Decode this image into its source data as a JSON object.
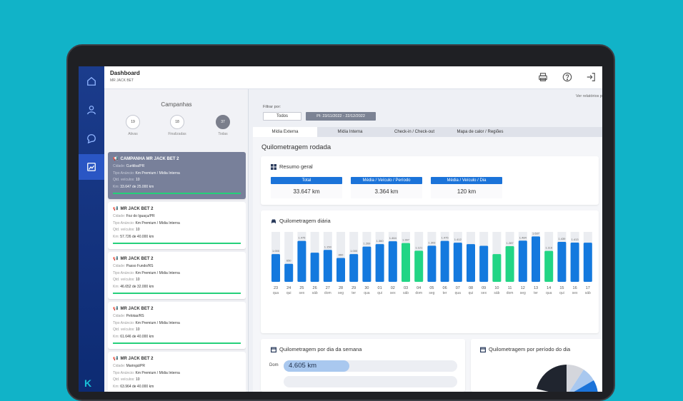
{
  "header": {
    "title": "Dashboard",
    "subtitle": "MR JACK BET"
  },
  "campaigns_panel": {
    "title": "Campanhas",
    "counters": [
      {
        "value": "19",
        "label": "Ativas"
      },
      {
        "value": "18",
        "label": "Finalizadas"
      },
      {
        "value": "37",
        "label": "Todas"
      }
    ],
    "field_labels": {
      "city": "Cidade:",
      "ad_type": "Tipo Anúncio:",
      "vehicles": "Qtd. veículos:",
      "km": "Km:"
    },
    "cards": [
      {
        "title": "CAMPANHA MR JACK BET 2",
        "city": "Curitiba/PR",
        "ad_type": "Km Premium / Mídia Interna",
        "vehicles": "10",
        "km": "33.647 de 25.000 km",
        "progress": 1.0
      },
      {
        "title": "MR JACK BET 2",
        "city": "Foz do Iguaçu/PR",
        "ad_type": "Km Premium / Mídia Interna",
        "vehicles": "10",
        "km": "57.726 de 40.000 km",
        "progress": 1.0
      },
      {
        "title": "MR JACK BET 2",
        "city": "Passo Fundo/RS",
        "ad_type": "Km Premium / Mídia Interna",
        "vehicles": "10",
        "km": "46.652 de 32.000 km",
        "progress": 1.0
      },
      {
        "title": "MR JACK BET 2",
        "city": "Pelotas/RS",
        "ad_type": "Km Premium / Mídia Interna",
        "vehicles": "10",
        "km": "61.646 de 40.000 km",
        "progress": 1.0
      },
      {
        "title": "MR JACK BET 2",
        "city": "Maringá/PR",
        "ad_type": "Km Premium / Mídia Interna",
        "vehicles": "10",
        "km": "63.964 de 40.000 km",
        "progress": 1.0
      }
    ]
  },
  "main": {
    "reports_link": "Ver relatórios p",
    "filter_label": "Filtrar por:",
    "filter_all": "Todos",
    "period": "PI: 23/11/2022 - 22/12/2022",
    "tabs": [
      "Mídia Externa",
      "Mídia Interna",
      "Check-in / Check-out",
      "Mapa de calor / Regiões"
    ],
    "section_title": "Quilometragem rodada",
    "summary": {
      "title": "Resumo geral",
      "kpis": [
        {
          "label": "Total",
          "value": "33.647 km"
        },
        {
          "label": "Média / Veículo / Período",
          "value": "3.364 km"
        },
        {
          "label": "Média / Veículo / Dia",
          "value": "120 km"
        }
      ]
    },
    "daily": {
      "title": "Quilometragem diária"
    },
    "weekday": {
      "title": "Quilometragem por dia da semana",
      "rows": [
        {
          "day": "Dom",
          "value": "4.605 km",
          "fraction": 0.38
        }
      ]
    },
    "period_of_day": {
      "title": "Quilometragem por período do dia"
    }
  },
  "colors": {
    "blue_bar": "#1479de",
    "green_bar": "#22d585",
    "bg_bar": "#ebedf1",
    "accent": "#1b73d9"
  },
  "chart_data": {
    "type": "bar",
    "title": "Quilometragem diária",
    "x": [
      "23",
      "24",
      "25",
      "26",
      "27",
      "28",
      "29",
      "30",
      "01",
      "02",
      "03",
      "04",
      "05",
      "06",
      "07",
      "08",
      "09",
      "10",
      "11",
      "12",
      "13",
      "14",
      "15",
      "16",
      "17"
    ],
    "x_sub": [
      "qua",
      "qui",
      "sex",
      "sáb",
      "dom",
      "seg",
      "ter",
      "qua",
      "qui",
      "sex",
      "sáb",
      "dom",
      "seg",
      "ter",
      "qua",
      "qui",
      "sex",
      "sáb",
      "dom",
      "seg",
      "ter",
      "qua",
      "qui",
      "sex",
      "sáb"
    ],
    "values": [
      1000,
      650,
      1475,
      1050,
      1150,
      860,
      1000,
      1269,
      1360,
      1464,
      1397,
      1121,
      1303,
      1475,
      1412,
      1360,
      1300,
      1000,
      1287,
      1484,
      1637,
      1116,
      1439,
      1413,
      1410
    ],
    "labels": [
      "1.000",
      "650",
      "1.475",
      "",
      "1.150",
      "860",
      "1.000",
      "1.269",
      "1.360",
      "1.464",
      "1.397",
      "1.121",
      "1.303",
      "1.475",
      "1.412",
      "",
      "",
      "",
      "1.287",
      "1.484",
      "1.637",
      "1.116",
      "1.439",
      "1.413",
      ""
    ],
    "series_colors": [
      "blue",
      "blue",
      "blue",
      "blue",
      "blue",
      "blue",
      "blue",
      "blue",
      "blue",
      "blue",
      "green",
      "green",
      "blue",
      "blue",
      "blue",
      "blue",
      "blue",
      "green",
      "green",
      "blue",
      "blue",
      "green",
      "blue",
      "blue",
      "blue"
    ],
    "ylim": [
      0,
      1800
    ]
  }
}
